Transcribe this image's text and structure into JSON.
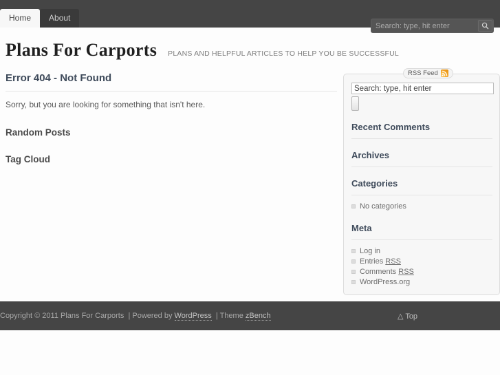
{
  "nav": {
    "items": [
      {
        "label": "Home",
        "active": true
      },
      {
        "label": "About",
        "active": false
      }
    ]
  },
  "header_search": {
    "placeholder": "Search: type, hit enter",
    "value": "",
    "button_icon": "search-icon"
  },
  "branding": {
    "site_title": "Plans For Carports",
    "tagline": "PLANS AND HELPFUL ARTICLES TO HELP YOU BE SUCCESSFUL"
  },
  "content": {
    "page_title": "Error 404 - Not Found",
    "body_text": "Sorry, but you are looking for something that isn't here.",
    "sections": [
      {
        "title": "Random Posts"
      },
      {
        "title": "Tag Cloud"
      }
    ]
  },
  "sidebar": {
    "legend_label": "RSS Feed",
    "legend_icon": "rss-icon",
    "search": {
      "placeholder": "Search: type, hit enter",
      "value": "",
      "submit_label": ""
    },
    "widgets": [
      {
        "title": "Recent Comments",
        "items": []
      },
      {
        "title": "Archives",
        "items": []
      },
      {
        "title": "Categories",
        "items": [
          {
            "text": "No categories",
            "link_part": ""
          }
        ]
      },
      {
        "title": "Meta",
        "items": [
          {
            "text": "Log in",
            "link_part": ""
          },
          {
            "text": "Entries ",
            "link_part": "RSS"
          },
          {
            "text": "Comments ",
            "link_part": "RSS"
          },
          {
            "text": "WordPress.org",
            "link_part": ""
          }
        ]
      }
    ]
  },
  "footer": {
    "copyright": "Copyright © 2011 Plans For Carports",
    "sep1": "|",
    "powered_by_prefix": "Powered by",
    "powered_by_link": "WordPress",
    "sep2": "|",
    "theme_prefix": "Theme",
    "theme_link": "zBench",
    "top_label": "△ Top"
  },
  "colors": {
    "bar": "#454545",
    "active_tab": "#f7f7f7",
    "heading": "#3f4b5b",
    "rss_orange": "#f5a623"
  }
}
